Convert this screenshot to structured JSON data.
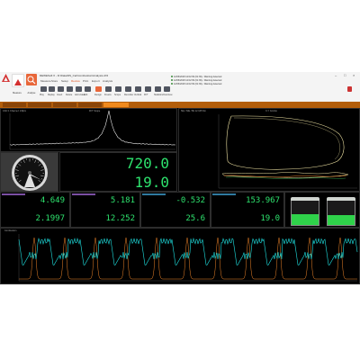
{
  "window": {
    "title": "DEWESoft X - D:\\Data\\DS_Car\\Combustion\\Analysis.d7d"
  },
  "ribbon": {
    "tabs": [
      "Measure",
      "Store",
      "Setup",
      "Review",
      "Print",
      "Export",
      "Analysis"
    ],
    "active_tab": "Review",
    "big_buttons": [
      {
        "label": "Measure",
        "color": "#ffffff",
        "icon": "dewesoft-logo"
      },
      {
        "label": "Analyse",
        "color": "#e8673a",
        "icon": "search-icon"
      }
    ],
    "buttons": [
      "Play",
      "Replay",
      "Insert",
      "Delete",
      "Add video",
      "Edit",
      "Design",
      "Freeze",
      "Scope",
      "Recorder",
      "Vertical",
      "FFT",
      "Statistics",
      "Overview"
    ],
    "messages": [
      "12/06/2018 12:02:39 (01:39) - Warning detected",
      "12/06/2018 12:02:39 (01:39) - Warning detected",
      "12/06/2018 12:02:39 (01:39) - Warning detected"
    ]
  },
  "display": {
    "panels": {
      "fft_title": "CAN 1 Channel: 1/Rpm",
      "fft_name": "FFT Scope",
      "xy_title": "Slip / ME / Bk 12.345 Nm",
      "xy_name": "X-Y Combo",
      "bottom_title": "Combustion"
    },
    "big_digitals": [
      "720.0",
      "19.0"
    ],
    "digitals_row1": [
      "4.649",
      "5.181",
      "-0.532",
      "153.967"
    ],
    "digitals_row2": [
      "2.1997",
      "12.252",
      "25.6",
      "19.0"
    ],
    "tanks": [
      0.45,
      0.42
    ]
  },
  "colors": {
    "accent": "#e8673a",
    "digit": "#2ee36e",
    "trace_cyan": "#1fe0e0",
    "trace_orange": "#f0862a",
    "trace_cream": "#f3e7a6",
    "fft_line": "#e8e8e8",
    "sheet_bar": "#b35e0b"
  }
}
